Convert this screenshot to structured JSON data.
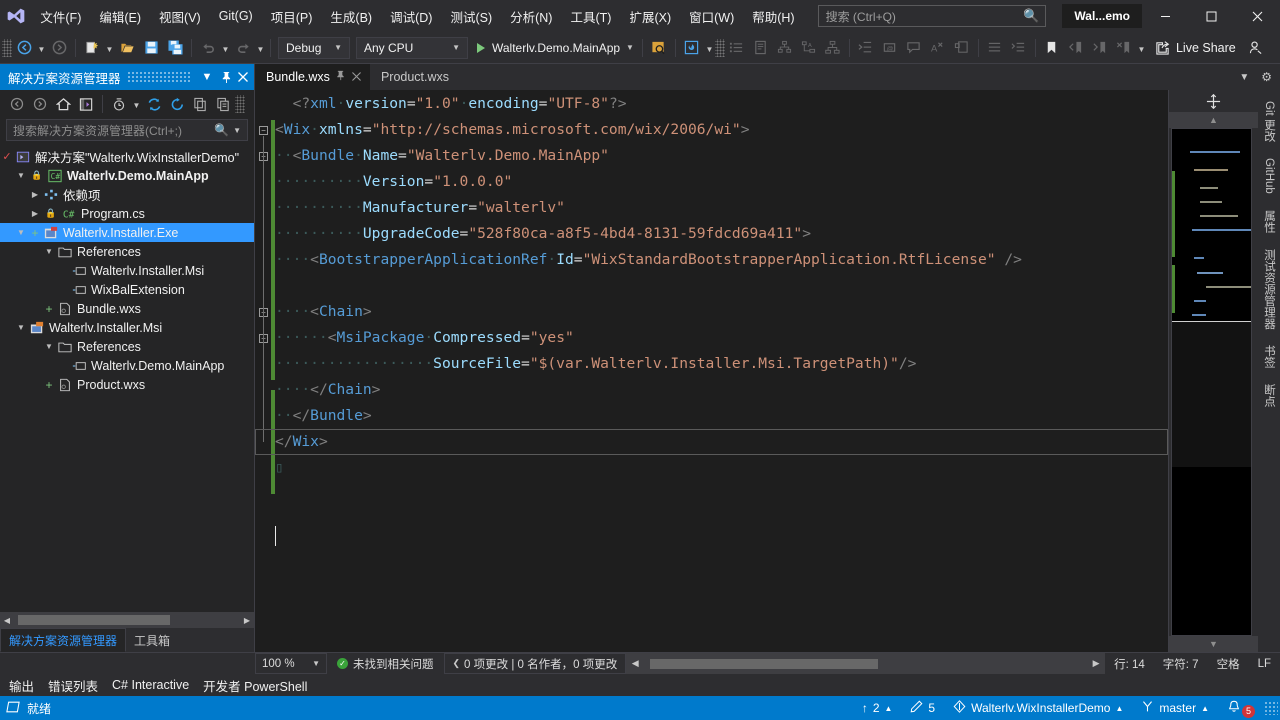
{
  "titlebar": {
    "logo_icon": "visual-studio-logo",
    "menus": [
      {
        "label": "文件(F)"
      },
      {
        "label": "编辑(E)"
      },
      {
        "label": "视图(V)"
      },
      {
        "label": "Git(G)"
      },
      {
        "label": "项目(P)"
      },
      {
        "label": "生成(B)"
      },
      {
        "label": "调试(D)"
      },
      {
        "label": "测试(S)"
      },
      {
        "label": "分析(N)"
      },
      {
        "label": "工具(T)"
      },
      {
        "label": "扩展(X)"
      },
      {
        "label": "窗口(W)"
      },
      {
        "label": "帮助(H)"
      }
    ],
    "search_placeholder": "搜索 (Ctrl+Q)",
    "search_icon": "search-icon",
    "solution_chip": "Wal...emo",
    "minimize_icon": "minimize-icon",
    "maximize_icon": "maximize-icon",
    "close_icon": "close-icon"
  },
  "toolbar": {
    "back_icon": "navigate-back-icon",
    "forward_icon": "navigate-forward-icon",
    "new_project_icon": "new-project-icon",
    "open_icon": "open-file-icon",
    "save_icon": "save-icon",
    "save_all_icon": "save-all-icon",
    "undo_icon": "undo-icon",
    "redo_icon": "redo-icon",
    "config_value": "Debug",
    "platform_value": "Any CPU",
    "start_label": "Walterlv.Demo.MainApp",
    "start_icon": "play-icon",
    "live_share_label": "Live Share",
    "live_share_icon": "live-share-icon",
    "add_account_icon": "add-user-icon"
  },
  "solution_explorer": {
    "title": "解决方案资源管理器",
    "dropdown_icon": "chevron-down-icon",
    "pin_icon": "pin-icon",
    "close_icon": "close-icon",
    "toolbar_icons": [
      "nav-back-icon",
      "nav-forward-icon",
      "home-icon",
      "switch-views-icon",
      "pending-changes-icon",
      "refresh-icon",
      "collapse-all-icon",
      "show-all-files-icon",
      "properties-icon"
    ],
    "search_placeholder": "搜索解决方案资源管理器(Ctrl+;)",
    "search_icon": "search-icon",
    "search_dropdown_icon": "chevron-down-icon",
    "tree": [
      {
        "label": "解决方案\"Walterlv.WixInstallerDemo\"",
        "indent": 0,
        "expander": "check",
        "icon": "solution-icon",
        "bold": false,
        "selected": false
      },
      {
        "label": "Walterlv.Demo.MainApp",
        "indent": 1,
        "expander": "open",
        "icon": "csharp-project-icon",
        "bold": true,
        "selected": false
      },
      {
        "label": "依赖项",
        "indent": 2,
        "expander": "closed",
        "icon": "dependencies-icon",
        "bold": false,
        "selected": false
      },
      {
        "label": "Program.cs",
        "indent": 2,
        "expander": "closed",
        "icon": "csharp-file-icon",
        "bold": false,
        "selected": false
      },
      {
        "label": "Walterlv.Installer.Exe",
        "indent": 1,
        "expander": "open",
        "icon": "wix-bundle-project-icon",
        "bold": false,
        "selected": true
      },
      {
        "label": "References",
        "indent": 2,
        "expander": "open",
        "icon": "folder-icon",
        "bold": false,
        "selected": false
      },
      {
        "label": "Walterlv.Installer.Msi",
        "indent": 3,
        "expander": "none",
        "icon": "reference-icon",
        "bold": false,
        "selected": false
      },
      {
        "label": "WixBalExtension",
        "indent": 3,
        "expander": "none",
        "icon": "reference-icon",
        "bold": false,
        "selected": false
      },
      {
        "label": "Bundle.wxs",
        "indent": 2,
        "expander": "plus",
        "icon": "wxs-file-icon",
        "bold": false,
        "selected": false
      },
      {
        "label": "Walterlv.Installer.Msi",
        "indent": 1,
        "expander": "open",
        "icon": "wix-msi-project-icon",
        "bold": false,
        "selected": false
      },
      {
        "label": "References",
        "indent": 2,
        "expander": "open",
        "icon": "folder-icon",
        "bold": false,
        "selected": false
      },
      {
        "label": "Walterlv.Demo.MainApp",
        "indent": 3,
        "expander": "none",
        "icon": "reference-icon",
        "bold": false,
        "selected": false
      },
      {
        "label": "Product.wxs",
        "indent": 2,
        "expander": "plus",
        "icon": "wxs-file-icon",
        "bold": false,
        "selected": false
      }
    ],
    "bottom_tabs": [
      {
        "label": "解决方案资源管理器",
        "active": true
      },
      {
        "label": "工具箱",
        "active": false
      }
    ]
  },
  "editor": {
    "tabs": [
      {
        "label": "Bundle.wxs",
        "active": true,
        "pin_icon": "pin-icon",
        "close_icon": "close-icon"
      },
      {
        "label": "Product.wxs",
        "active": false
      }
    ],
    "tabstrip_dropdown_icon": "chevron-down-icon",
    "tabstrip_settings_icon": "gear-icon",
    "code_lines": [
      "<?xml version=\"1.0\" encoding=\"UTF-8\"?>",
      "<Wix xmlns=\"http://schemas.microsoft.com/wix/2006/wi\">",
      "  <Bundle Name=\"Walterlv.Demo.MainApp\"",
      "          Version=\"1.0.0.0\"",
      "          Manufacturer=\"walterlv\"",
      "          UpgradeCode=\"528f80ca-a8f5-4bd4-8131-59fdcd69a411\">",
      "    <BootstrapperApplicationRef Id=\"WixStandardBootstrapperApplication.RtfLicense\" />",
      "",
      "    <Chain>",
      "      <MsiPackage Compressed=\"yes\"",
      "                  SourceFile=\"$(var.Walterlv.Installer.Msi.TargetPath)\"/>",
      "    </Chain>",
      "  </Bundle>",
      "</Wix>",
      ""
    ],
    "scroll_up_icon": "chevron-up-icon",
    "scroll_down_icon": "chevron-down-icon",
    "split_icon": "split-view-icon"
  },
  "right_rail": {
    "tabs": [
      {
        "label": "Git 更改"
      },
      {
        "label": "GitHub"
      },
      {
        "label": "属性"
      },
      {
        "label": "测试资源管理器"
      },
      {
        "label": "书签"
      },
      {
        "label": "断点"
      }
    ]
  },
  "editor_status": {
    "zoom": "100 %",
    "zoom_dropdown_icon": "chevron-down-icon",
    "issues_text": "未找到相关问题",
    "issues_icon": "check-circle-icon",
    "changes_prev_icon": "chevron-left-icon",
    "changes_text": "0 项更改 | 0 名作者，0 项更改",
    "hscroll_left_icon": "arrow-left-icon",
    "hscroll_right_icon": "arrow-right-icon",
    "line_label": "行: 14",
    "char_label": "字符: 7",
    "indent_label": "空格",
    "eol_label": "LF"
  },
  "bottom_panels": {
    "tabs": [
      {
        "label": "输出"
      },
      {
        "label": "错误列表"
      },
      {
        "label": "C# Interactive"
      },
      {
        "label": "开发者 PowerShell"
      }
    ]
  },
  "statusbar": {
    "ready_icon": "ready-icon",
    "ready_text": "就绪",
    "outgoing_icon": "arrow-up-icon",
    "outgoing_count": "2",
    "outgoing_caret_icon": "chevron-up-icon",
    "unpublished_icon": "pencil-icon",
    "unpublished_count": "5",
    "repo_icon": "git-repo-icon",
    "repo_name": "Walterlv.WixInstallerDemo",
    "repo_caret_icon": "chevron-up-icon",
    "branch_icon": "branch-icon",
    "branch_name": "master",
    "branch_caret_icon": "chevron-up-icon",
    "notifications_icon": "bell-icon",
    "notifications_count": "5",
    "resize_grip_icon": "resize-grip-icon"
  },
  "colors": {
    "accent": "#007acc",
    "selection": "#3399ff",
    "editor_bg": "#1e1e1e",
    "chrome_bg": "#2d2d30",
    "panel_bg": "#252526",
    "tagname": "#569cd6",
    "attr": "#9cdcfe",
    "value": "#ce9178",
    "delim": "#808080",
    "change_bar": "#4e8a34",
    "badge_red": "#d13438"
  }
}
